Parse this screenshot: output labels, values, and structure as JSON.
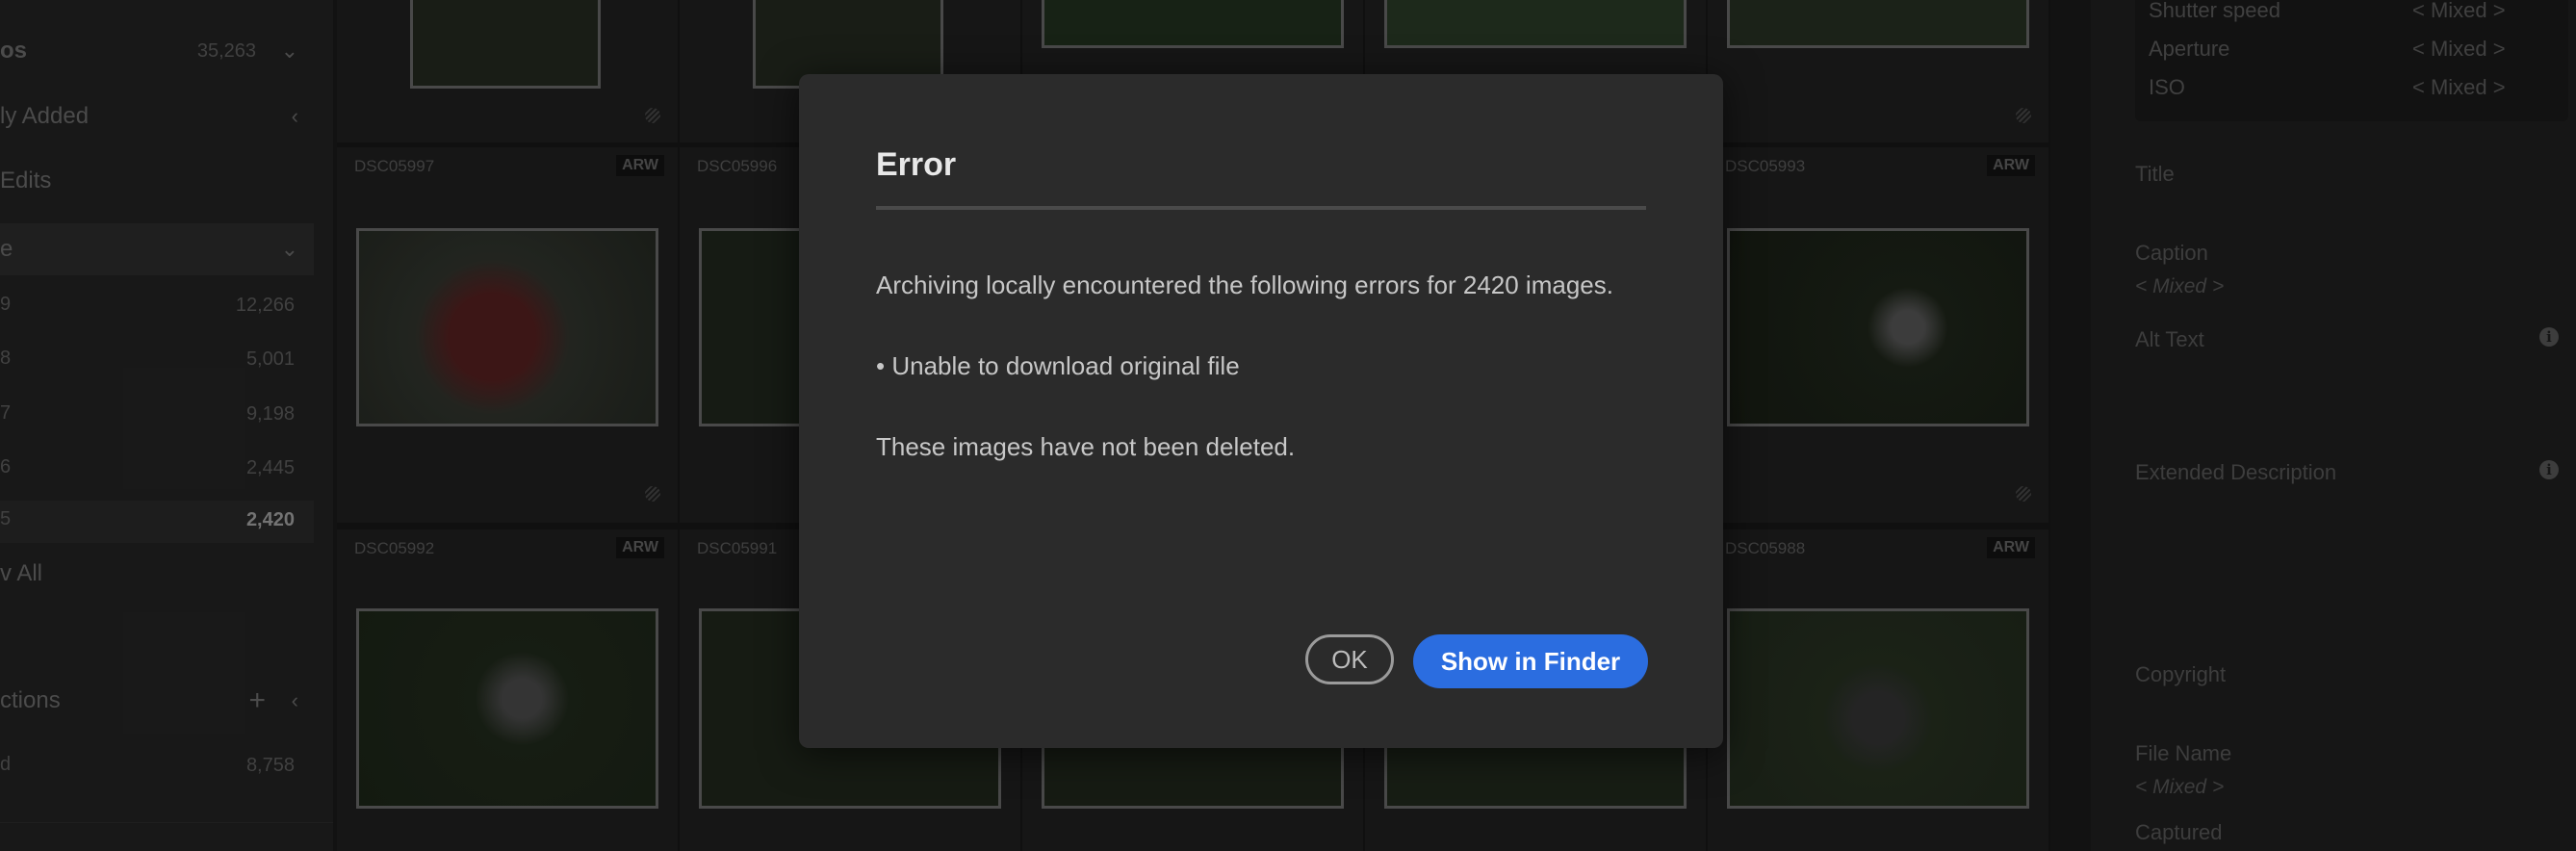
{
  "sidebar": {
    "all_photos": {
      "label": "os",
      "count": "35,263"
    },
    "recently_added": {
      "label": "ly Added"
    },
    "edits": {
      "label": " Edits"
    },
    "by_date": {
      "label": "e"
    },
    "years": [
      {
        "label": "9",
        "count": "12,266"
      },
      {
        "label": "8",
        "count": "5,001"
      },
      {
        "label": "7",
        "count": "9,198"
      },
      {
        "label": "6",
        "count": "2,445"
      },
      {
        "label": "5",
        "count": "2,420"
      }
    ],
    "view_all": "v All",
    "collections": {
      "label": "ctions"
    },
    "album": {
      "label": "d",
      "count": "8,758"
    }
  },
  "grid": {
    "row2": [
      {
        "name": "DSC05997",
        "badge": "ARW"
      },
      {
        "name": "DSC05996",
        "badge": ""
      },
      {
        "name": "",
        "badge": ""
      },
      {
        "name": "",
        "badge": ""
      },
      {
        "name": "DSC05993",
        "badge": "ARW"
      }
    ],
    "row3": [
      {
        "name": "DSC05992",
        "badge": "ARW"
      },
      {
        "name": "DSC05991",
        "badge": ""
      },
      {
        "name": "",
        "badge": ""
      },
      {
        "name": "",
        "badge": ""
      },
      {
        "name": "DSC05988",
        "badge": "ARW"
      }
    ]
  },
  "right_panel": {
    "exif": [
      {
        "label": "Shutter speed",
        "value": "< Mixed >"
      },
      {
        "label": "Aperture",
        "value": "< Mixed >"
      },
      {
        "label": "ISO",
        "value": "< Mixed >"
      }
    ],
    "title_label": "Title",
    "caption_label": "Caption",
    "caption_value": "< Mixed >",
    "alt_text_label": "Alt Text",
    "extended_label": "Extended Description",
    "copyright_label": "Copyright",
    "filename_label": "File Name",
    "filename_value": "< Mixed >",
    "captured_label": "Captured",
    "info_glyph": "i"
  },
  "dialog": {
    "title": "Error",
    "message": "Archiving locally encountered the following errors for 2420 images.",
    "bullet": "• Unable to download original file",
    "note": "These images have not been deleted.",
    "ok_label": "OK",
    "finder_label": "Show in Finder",
    "accent": "#2b6de0"
  }
}
